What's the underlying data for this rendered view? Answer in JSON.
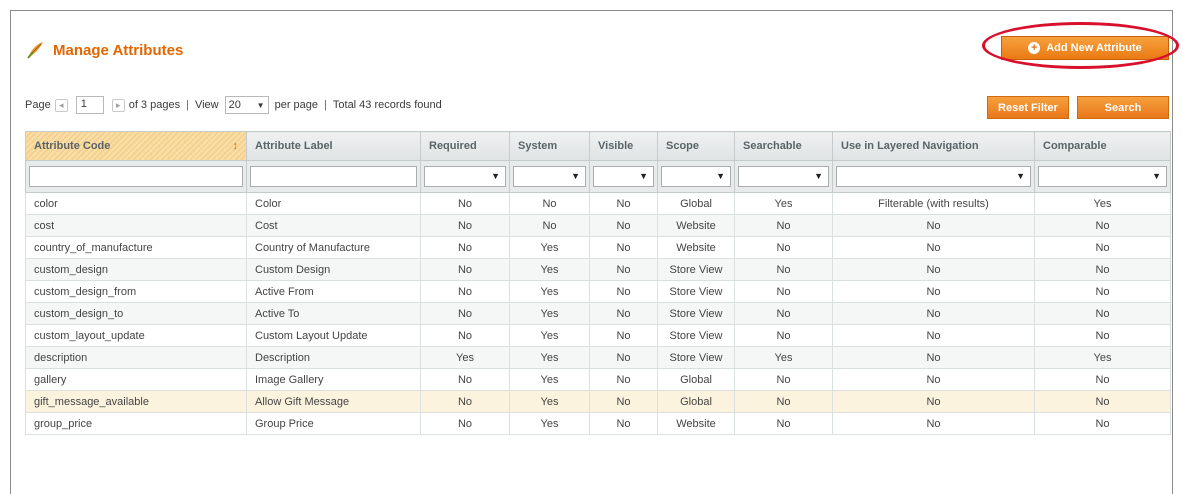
{
  "header": {
    "title": "Manage Attributes",
    "add_button": "Add New Attribute"
  },
  "pager": {
    "page_label": "Page",
    "current_page": "1",
    "of_pages": "of 3 pages",
    "view_label": "View",
    "per_page_value": "20",
    "per_page_label": "per page",
    "total": "Total 43 records found",
    "separator": "|"
  },
  "actions": {
    "reset_filter": "Reset Filter",
    "search": "Search"
  },
  "columns": [
    "Attribute Code",
    "Attribute Label",
    "Required",
    "System",
    "Visible",
    "Scope",
    "Searchable",
    "Use in Layered Navigation",
    "Comparable"
  ],
  "rows": [
    [
      "color",
      "Color",
      "No",
      "No",
      "No",
      "Global",
      "Yes",
      "Filterable (with results)",
      "Yes"
    ],
    [
      "cost",
      "Cost",
      "No",
      "No",
      "No",
      "Website",
      "No",
      "No",
      "No"
    ],
    [
      "country_of_manufacture",
      "Country of Manufacture",
      "No",
      "Yes",
      "No",
      "Website",
      "No",
      "No",
      "No"
    ],
    [
      "custom_design",
      "Custom Design",
      "No",
      "Yes",
      "No",
      "Store View",
      "No",
      "No",
      "No"
    ],
    [
      "custom_design_from",
      "Active From",
      "No",
      "Yes",
      "No",
      "Store View",
      "No",
      "No",
      "No"
    ],
    [
      "custom_design_to",
      "Active To",
      "No",
      "Yes",
      "No",
      "Store View",
      "No",
      "No",
      "No"
    ],
    [
      "custom_layout_update",
      "Custom Layout Update",
      "No",
      "Yes",
      "No",
      "Store View",
      "No",
      "No",
      "No"
    ],
    [
      "description",
      "Description",
      "Yes",
      "Yes",
      "No",
      "Store View",
      "Yes",
      "No",
      "Yes"
    ],
    [
      "gallery",
      "Image Gallery",
      "No",
      "Yes",
      "No",
      "Global",
      "No",
      "No",
      "No"
    ],
    [
      "gift_message_available",
      "Allow Gift Message",
      "No",
      "Yes",
      "No",
      "Global",
      "No",
      "No",
      "No"
    ],
    [
      "group_price",
      "Group Price",
      "No",
      "Yes",
      "No",
      "Website",
      "No",
      "No",
      "No"
    ]
  ],
  "colors": {
    "accent": "#e26703",
    "button": "#ea7a14",
    "highlight_ring": "#d7102c"
  }
}
